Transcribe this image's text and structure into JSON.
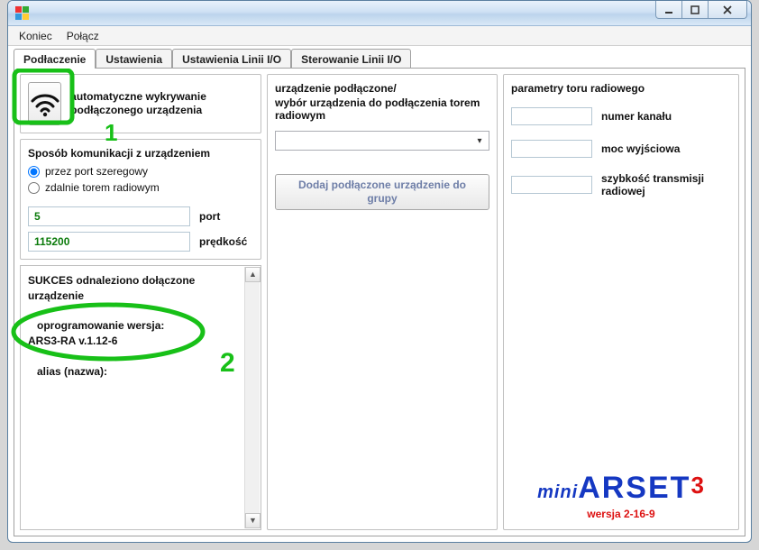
{
  "window": {
    "title": ""
  },
  "menu": {
    "items": [
      "Koniec",
      "Połącz"
    ]
  },
  "tabs": [
    "Podłaczenie",
    "Ustawienia",
    "Ustawienia Linii I/O",
    "Sterowanie Linii I/O"
  ],
  "active_tab": 0,
  "left": {
    "detect_label": "automatyczne wykrywanie podłączonego urządzenia",
    "comm_legend": "Sposób komunikacji z urządzeniem",
    "radio_serial": "przez port szeregowy",
    "radio_rf": "zdalnie torem radiowym",
    "selected_radio": "serial",
    "port_value": "5",
    "port_label": "port",
    "baud_value": "115200",
    "baud_label": "prędkość",
    "log": {
      "line1": "SUKCES odnaleziono dołączone urządzenie",
      "line2": "oprogramowanie wersja:",
      "line3": "ARS3-RA v.1.12-6",
      "line4": "alias (nazwa):"
    }
  },
  "middle": {
    "legend_a": "urządzenie podłączone/",
    "legend_b": "wybór urządzenia do podłączenia torem radiowym",
    "combo_value": "",
    "add_button": "Dodaj podłączone urządzenie do grupy"
  },
  "right": {
    "legend": "parametry toru radiowego",
    "channel_label": "numer kanału",
    "channel_value": "",
    "power_label": "moc wyjściowa",
    "power_value": "",
    "speed_label": "szybkość transmisji radiowej",
    "speed_value": ""
  },
  "brand": {
    "mini": "mini",
    "name": "ARSET",
    "sup": "3",
    "version": "wersja 2-16-9"
  },
  "annotations": {
    "marker1": "1",
    "marker2": "2"
  }
}
